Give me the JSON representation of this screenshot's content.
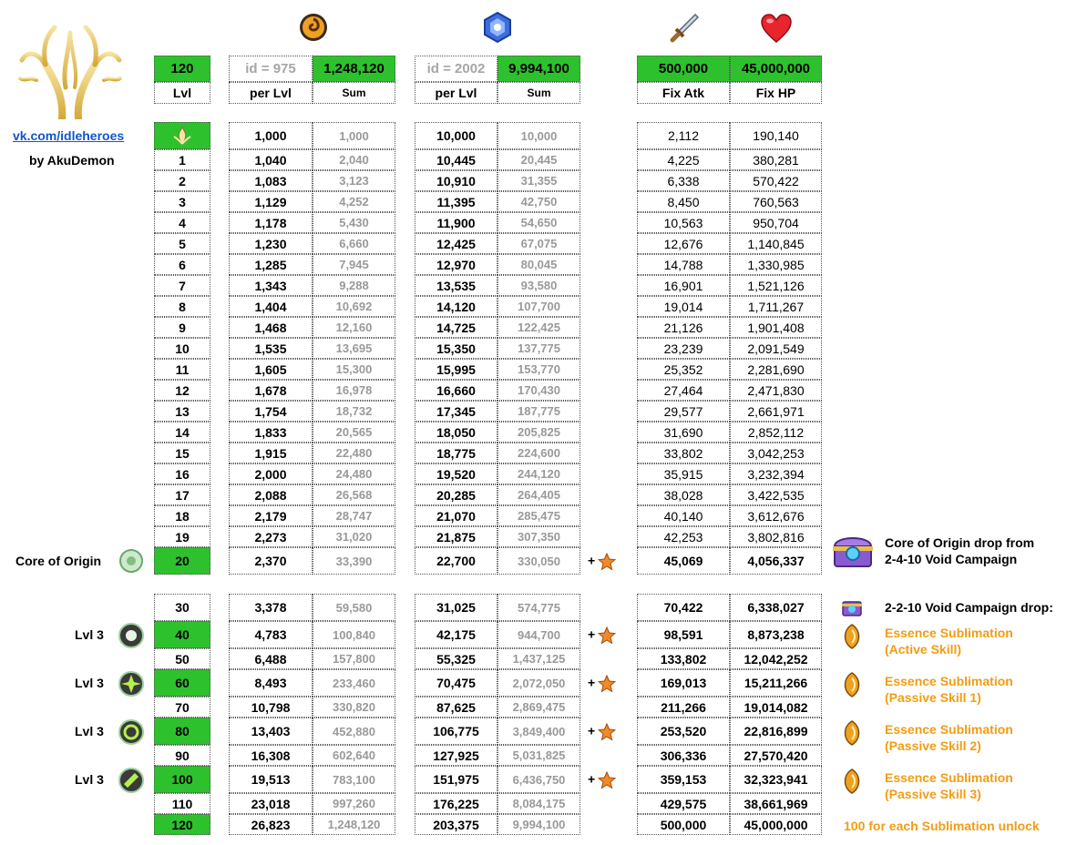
{
  "header": {
    "level_cap": "120",
    "level_label": "Lvl",
    "res1": {
      "id": "id = 975",
      "total": "1,248,120",
      "per_label": "per Lvl",
      "sum_label": "Sum"
    },
    "res2": {
      "id": "id = 2002",
      "total": "9,994,100",
      "per_label": "per Lvl",
      "sum_label": "Sum"
    },
    "fix_atk": {
      "value": "500,000",
      "label": "Fix Atk"
    },
    "fix_hp": {
      "value": "45,000,000",
      "label": "Fix HP"
    }
  },
  "sidebar": {
    "link": "vk.com/idleheroes",
    "author": "by AkuDemon",
    "core_label": "Core of Origin",
    "lvl_labels": [
      "Lvl 3",
      "Lvl 3",
      "Lvl 3",
      "Lvl 3"
    ]
  },
  "rows_top": [
    {
      "lvl": "",
      "a": "1,000",
      "as": "1,000",
      "b": "10,000",
      "bs": "10,000",
      "atk": "2,112",
      "hp": "190,140"
    },
    {
      "lvl": "1",
      "a": "1,040",
      "as": "2,040",
      "b": "10,445",
      "bs": "20,445",
      "atk": "4,225",
      "hp": "380,281"
    },
    {
      "lvl": "2",
      "a": "1,083",
      "as": "3,123",
      "b": "10,910",
      "bs": "31,355",
      "atk": "6,338",
      "hp": "570,422"
    },
    {
      "lvl": "3",
      "a": "1,129",
      "as": "4,252",
      "b": "11,395",
      "bs": "42,750",
      "atk": "8,450",
      "hp": "760,563"
    },
    {
      "lvl": "4",
      "a": "1,178",
      "as": "5,430",
      "b": "11,900",
      "bs": "54,650",
      "atk": "10,563",
      "hp": "950,704"
    },
    {
      "lvl": "5",
      "a": "1,230",
      "as": "6,660",
      "b": "12,425",
      "bs": "67,075",
      "atk": "12,676",
      "hp": "1,140,845"
    },
    {
      "lvl": "6",
      "a": "1,285",
      "as": "7,945",
      "b": "12,970",
      "bs": "80,045",
      "atk": "14,788",
      "hp": "1,330,985"
    },
    {
      "lvl": "7",
      "a": "1,343",
      "as": "9,288",
      "b": "13,535",
      "bs": "93,580",
      "atk": "16,901",
      "hp": "1,521,126"
    },
    {
      "lvl": "8",
      "a": "1,404",
      "as": "10,692",
      "b": "14,120",
      "bs": "107,700",
      "atk": "19,014",
      "hp": "1,711,267"
    },
    {
      "lvl": "9",
      "a": "1,468",
      "as": "12,160",
      "b": "14,725",
      "bs": "122,425",
      "atk": "21,126",
      "hp": "1,901,408"
    },
    {
      "lvl": "10",
      "a": "1,535",
      "as": "13,695",
      "b": "15,350",
      "bs": "137,775",
      "atk": "23,239",
      "hp": "2,091,549"
    },
    {
      "lvl": "11",
      "a": "1,605",
      "as": "15,300",
      "b": "15,995",
      "bs": "153,770",
      "atk": "25,352",
      "hp": "2,281,690"
    },
    {
      "lvl": "12",
      "a": "1,678",
      "as": "16,978",
      "b": "16,660",
      "bs": "170,430",
      "atk": "27,464",
      "hp": "2,471,830"
    },
    {
      "lvl": "13",
      "a": "1,754",
      "as": "18,732",
      "b": "17,345",
      "bs": "187,775",
      "atk": "29,577",
      "hp": "2,661,971"
    },
    {
      "lvl": "14",
      "a": "1,833",
      "as": "20,565",
      "b": "18,050",
      "bs": "205,825",
      "atk": "31,690",
      "hp": "2,852,112"
    },
    {
      "lvl": "15",
      "a": "1,915",
      "as": "22,480",
      "b": "18,775",
      "bs": "224,600",
      "atk": "33,802",
      "hp": "3,042,253"
    },
    {
      "lvl": "16",
      "a": "2,000",
      "as": "24,480",
      "b": "19,520",
      "bs": "244,120",
      "atk": "35,915",
      "hp": "3,232,394"
    },
    {
      "lvl": "17",
      "a": "2,088",
      "as": "26,568",
      "b": "20,285",
      "bs": "264,405",
      "atk": "38,028",
      "hp": "3,422,535"
    },
    {
      "lvl": "18",
      "a": "2,179",
      "as": "28,747",
      "b": "21,070",
      "bs": "285,475",
      "atk": "40,140",
      "hp": "3,612,676"
    },
    {
      "lvl": "19",
      "a": "2,273",
      "as": "31,020",
      "b": "21,875",
      "bs": "307,350",
      "atk": "42,253",
      "hp": "3,802,816"
    },
    {
      "lvl": "20",
      "a": "2,370",
      "as": "33,390",
      "b": "22,700",
      "bs": "330,050",
      "atk": "45,069",
      "hp": "4,056,337",
      "star": "+"
    }
  ],
  "rows_bottom": [
    {
      "lvl": "30",
      "a": "3,378",
      "as": "59,580",
      "b": "31,025",
      "bs": "574,775",
      "atk": "70,422",
      "hp": "6,338,027"
    },
    {
      "lvl": "40",
      "a": "4,783",
      "as": "100,840",
      "b": "42,175",
      "bs": "944,700",
      "atk": "98,591",
      "hp": "8,873,238",
      "star": "+"
    },
    {
      "lvl": "50",
      "a": "6,488",
      "as": "157,800",
      "b": "55,325",
      "bs": "1,437,125",
      "atk": "133,802",
      "hp": "12,042,252"
    },
    {
      "lvl": "60",
      "a": "8,493",
      "as": "233,460",
      "b": "70,475",
      "bs": "2,072,050",
      "atk": "169,013",
      "hp": "15,211,266",
      "star": "+"
    },
    {
      "lvl": "70",
      "a": "10,798",
      "as": "330,820",
      "b": "87,625",
      "bs": "2,869,475",
      "atk": "211,266",
      "hp": "19,014,082"
    },
    {
      "lvl": "80",
      "a": "13,403",
      "as": "452,880",
      "b": "106,775",
      "bs": "3,849,400",
      "atk": "253,520",
      "hp": "22,816,899",
      "star": "+"
    },
    {
      "lvl": "90",
      "a": "16,308",
      "as": "602,640",
      "b": "127,925",
      "bs": "5,031,825",
      "atk": "306,336",
      "hp": "27,570,420"
    },
    {
      "lvl": "100",
      "a": "19,513",
      "as": "783,100",
      "b": "151,975",
      "bs": "6,436,750",
      "atk": "359,153",
      "hp": "32,323,941",
      "star": "+"
    },
    {
      "lvl": "110",
      "a": "23,018",
      "as": "997,260",
      "b": "176,225",
      "bs": "8,084,175",
      "atk": "429,575",
      "hp": "38,661,969"
    },
    {
      "lvl": "120",
      "a": "26,823",
      "as": "1,248,120",
      "b": "203,375",
      "bs": "9,994,100",
      "atk": "500,000",
      "hp": "45,000,000"
    }
  ],
  "right": {
    "core_drop_1": "Core of Origin drop from",
    "core_drop_2": "2-4-10 Void Campaign",
    "void_drop": "2-2-10 Void Campaign drop:",
    "ess": [
      {
        "l1": "Essence Sublimation",
        "l2": "(Active Skill)"
      },
      {
        "l1": "Essence Sublimation",
        "l2": "(Passive Skill 1)"
      },
      {
        "l1": "Essence Sublimation",
        "l2": "(Passive Skill 2)"
      },
      {
        "l1": "Essence Sublimation",
        "l2": "(Passive Skill 3)"
      }
    ],
    "footer": "100 for each Sublimation unlock"
  },
  "colors": {
    "green": "#2ec12e",
    "orange": "#f39c12",
    "link": "#1155cc"
  },
  "icons": [
    "tree-logo-icon",
    "orange-orb-icon",
    "blue-crystal-icon",
    "sword-icon",
    "heart-icon",
    "core-of-origin-icon",
    "star-icon",
    "chest-icon",
    "essence-icon"
  ]
}
